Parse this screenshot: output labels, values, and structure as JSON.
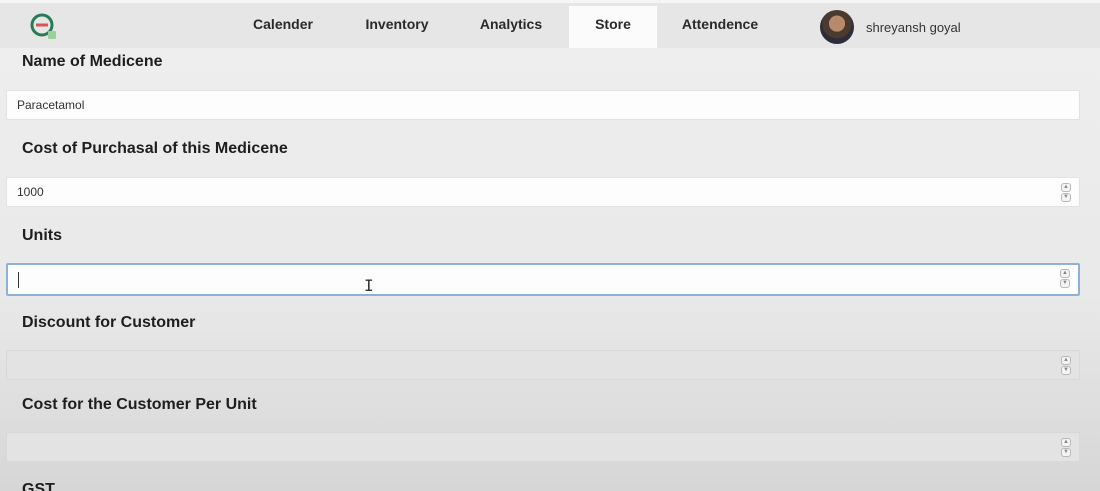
{
  "nav": {
    "tabs": [
      {
        "label": "Calender"
      },
      {
        "label": "Inventory"
      },
      {
        "label": "Analytics"
      },
      {
        "label": "Store",
        "active": true
      },
      {
        "label": "Attendence"
      }
    ],
    "user_name": "shreyansh goyal",
    "logo_icon": "pharmacy-logo-icon",
    "avatar_icon": "user-avatar"
  },
  "form": {
    "name_label": "Name of Medicene",
    "name_value": "Paracetamol",
    "cost_label": "Cost of Purchasal of this Medicene",
    "cost_value": "1000",
    "units_label": "Units",
    "units_value": "",
    "discount_label": "Discount for Customer",
    "discount_value": "",
    "customer_cost_label": "Cost for the Customer Per Unit",
    "customer_cost_value": "",
    "gst_label": "GST"
  },
  "colors": {
    "accent_logo": "#2a7a5a",
    "focus_border": "#8fb0d8"
  }
}
